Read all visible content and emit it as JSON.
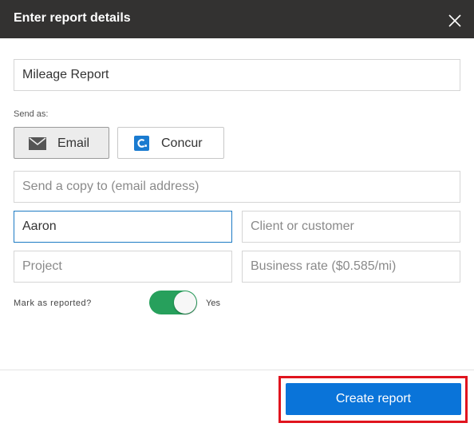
{
  "dialog": {
    "title": "Enter report details",
    "close_icon": "close-icon"
  },
  "report_name": {
    "value": "Mileage Report"
  },
  "send_as": {
    "label": "Send as:",
    "options": [
      {
        "label": "Email",
        "icon": "email-icon",
        "selected": true
      },
      {
        "label": "Concur",
        "icon": "concur-logo-icon",
        "selected": false
      }
    ]
  },
  "copy_email": {
    "value": "",
    "placeholder": "Send a copy to (email address)"
  },
  "driver": {
    "value": "Aaron",
    "placeholder": ""
  },
  "client": {
    "value": "",
    "placeholder": "Client or customer"
  },
  "project": {
    "value": "",
    "placeholder": "Project"
  },
  "business_rate": {
    "value": "",
    "placeholder": "Business rate ($0.585/mi)"
  },
  "mark_reported": {
    "label": "Mark as reported?",
    "on": true,
    "value_label": "Yes"
  },
  "footer": {
    "create_label": "Create report"
  },
  "colors": {
    "header_bg": "#333231",
    "toggle_on": "#27a05c",
    "primary": "#0a74d9",
    "focus_border": "#1d7bc4",
    "highlight": "#e0141e",
    "concur_brand": "#1a7bd0"
  }
}
